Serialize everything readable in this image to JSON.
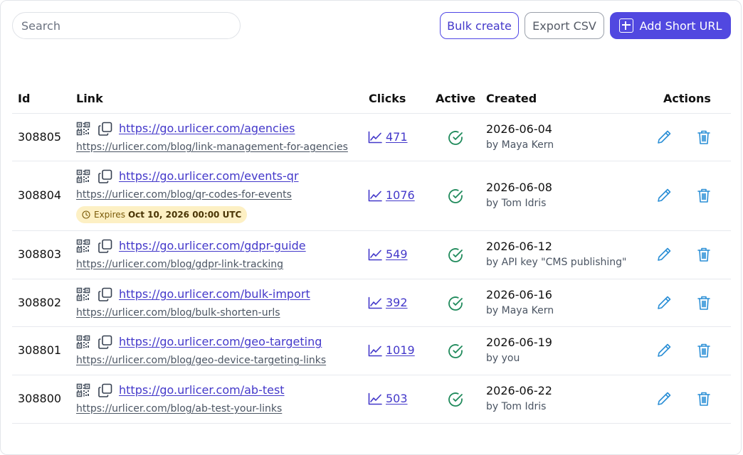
{
  "toolbar": {
    "search_placeholder": "Search",
    "bulk_label": "Bulk create",
    "export_label": "Export CSV",
    "add_label": "Add Short URL"
  },
  "table": {
    "headers": {
      "id": "Id",
      "link": "Link",
      "clicks": "Clicks",
      "active": "Active",
      "created": "Created",
      "actions": "Actions"
    },
    "rows": [
      {
        "id": "308805",
        "short": "https://go.urlicer.com/agencies",
        "long": "https://urlicer.com/blog/link-management-for-agencies",
        "clicks": "471",
        "date": "2026-06-04",
        "by": "by Maya Kern"
      },
      {
        "id": "308804",
        "short": "https://go.urlicer.com/events-qr",
        "long": "https://urlicer.com/blog/qr-codes-for-events",
        "clicks": "1076",
        "date": "2026-06-08",
        "by": "by Tom Idris",
        "expires_label": "Expires",
        "expires_value": "Oct 10, 2026 00:00 UTC"
      },
      {
        "id": "308803",
        "short": "https://go.urlicer.com/gdpr-guide",
        "long": "https://urlicer.com/blog/gdpr-link-tracking",
        "clicks": "549",
        "date": "2026-06-12",
        "by": "by API key \"CMS publishing\""
      },
      {
        "id": "308802",
        "short": "https://go.urlicer.com/bulk-import",
        "long": "https://urlicer.com/blog/bulk-shorten-urls",
        "clicks": "392",
        "date": "2026-06-16",
        "by": "by Maya Kern"
      },
      {
        "id": "308801",
        "short": "https://go.urlicer.com/geo-targeting",
        "long": "https://urlicer.com/blog/geo-device-targeting-links",
        "clicks": "1019",
        "date": "2026-06-19",
        "by": "by you"
      },
      {
        "id": "308800",
        "short": "https://go.urlicer.com/ab-test",
        "long": "https://urlicer.com/blog/ab-test-your-links",
        "clicks": "503",
        "date": "2026-06-22",
        "by": "by Tom Idris"
      }
    ]
  },
  "icons": {
    "qr": "qr-code-icon",
    "copy": "copy-icon",
    "clicks": "line-chart-icon",
    "active": "check-circle-icon",
    "edit": "pencil-icon",
    "delete": "trash-icon",
    "expires": "clock-icon",
    "add": "plus-square-icon"
  },
  "colors": {
    "accent": "#5148e0",
    "link": "#4338ca",
    "active": "#1f8a5b",
    "action_icons": "#2b8fd6",
    "expires_bg": "#fdf0c4"
  }
}
